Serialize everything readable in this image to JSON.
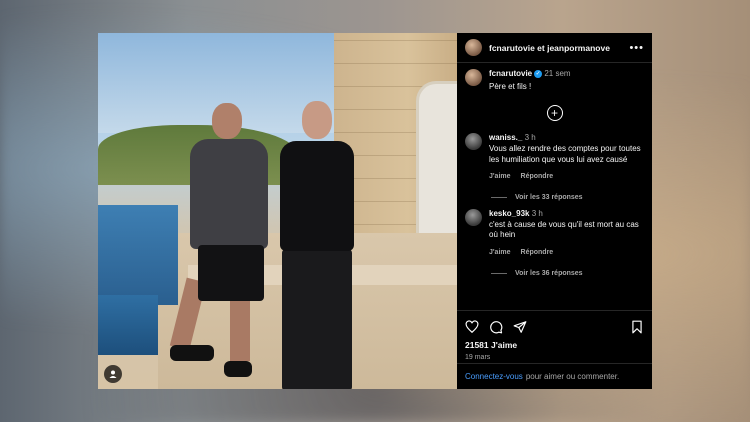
{
  "header": {
    "title": "fcnarutovie et jeanpormanove",
    "more_icon": "more-horizontal-icon"
  },
  "caption": {
    "username": "fcnarutovie",
    "time": "21 sem",
    "text": "Père et fils !"
  },
  "load_more_icon": "plus-circle-icon",
  "comments": [
    {
      "username": "waniss._",
      "time": "3 h",
      "text": "Vous allez rendre des comptes pour toutes les humiliation que vous lui avez causé",
      "like_label": "J'aime",
      "reply_label": "Répondre",
      "view_replies": "Voir les 33 réponses"
    },
    {
      "username": "kesko_93k",
      "time": "3 h",
      "text": "c'est à cause de vous qu'il est mort au cas où hein",
      "like_label": "J'aime",
      "reply_label": "Répondre",
      "view_replies": "Voir les 36 réponses"
    }
  ],
  "actions": {
    "icons": [
      "heart-icon",
      "comment-icon",
      "share-icon",
      "bookmark-icon"
    ]
  },
  "likes": "21581 J'aime",
  "date": "19 mars",
  "login_prompt": {
    "link": "Connectez-vous",
    "text": "pour aimer ou commenter."
  },
  "colors": {
    "background": "#000000",
    "link": "#4a9eff",
    "verified": "#1d9bf0",
    "muted_text": "#a8a8a8"
  }
}
